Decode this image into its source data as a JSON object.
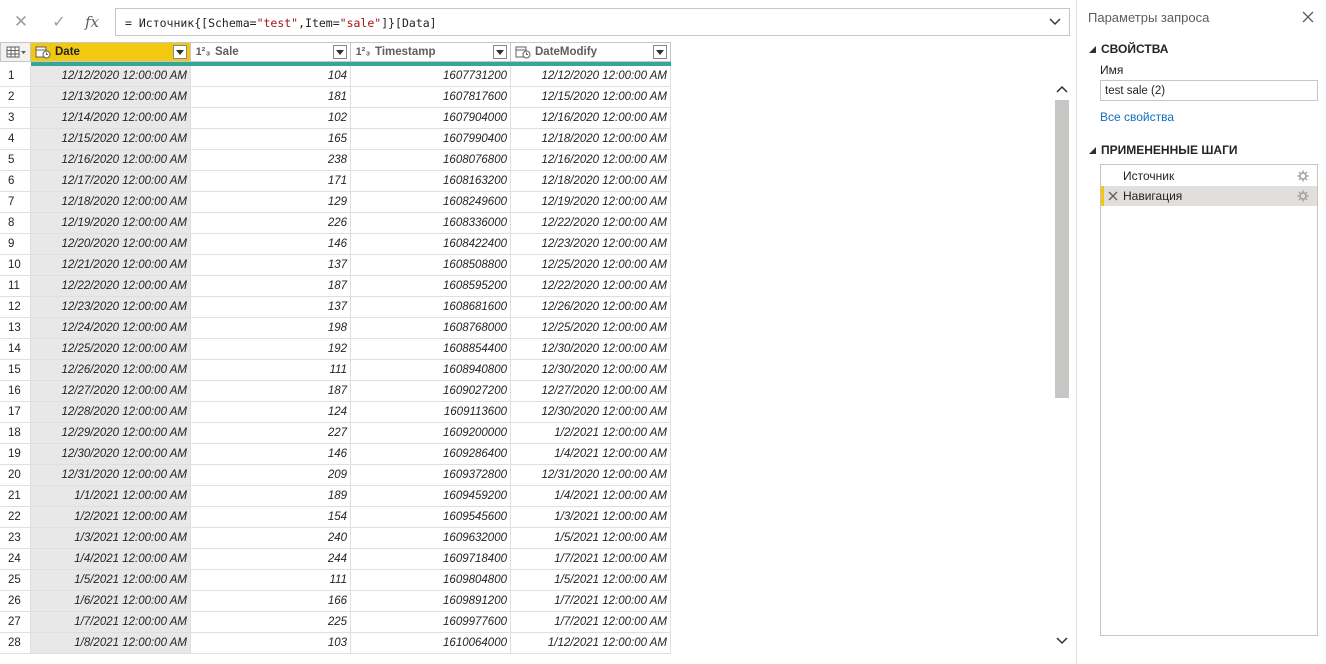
{
  "formula": {
    "prefix": "= Источник{[Schema=",
    "s1": "\"test\"",
    "mid": ",Item=",
    "s2": "\"sale\"",
    "suffix": "]}[Data]"
  },
  "columns": [
    {
      "label": "Date",
      "type_icon": "datetime-type-icon",
      "selected": true
    },
    {
      "label": "Sale",
      "type_icon": "number-type-icon",
      "selected": false
    },
    {
      "label": "Timestamp",
      "type_icon": "number-type-icon",
      "selected": false
    },
    {
      "label": "DateModify",
      "type_icon": "datetime-type-icon",
      "selected": false
    }
  ],
  "rows": [
    {
      "n": "1",
      "date": "12/12/2020 12:00:00 AM",
      "sale": "104",
      "ts": "1607731200",
      "mod": "12/12/2020 12:00:00 AM"
    },
    {
      "n": "2",
      "date": "12/13/2020 12:00:00 AM",
      "sale": "181",
      "ts": "1607817600",
      "mod": "12/15/2020 12:00:00 AM"
    },
    {
      "n": "3",
      "date": "12/14/2020 12:00:00 AM",
      "sale": "102",
      "ts": "1607904000",
      "mod": "12/16/2020 12:00:00 AM"
    },
    {
      "n": "4",
      "date": "12/15/2020 12:00:00 AM",
      "sale": "165",
      "ts": "1607990400",
      "mod": "12/18/2020 12:00:00 AM"
    },
    {
      "n": "5",
      "date": "12/16/2020 12:00:00 AM",
      "sale": "238",
      "ts": "1608076800",
      "mod": "12/16/2020 12:00:00 AM"
    },
    {
      "n": "6",
      "date": "12/17/2020 12:00:00 AM",
      "sale": "171",
      "ts": "1608163200",
      "mod": "12/18/2020 12:00:00 AM"
    },
    {
      "n": "7",
      "date": "12/18/2020 12:00:00 AM",
      "sale": "129",
      "ts": "1608249600",
      "mod": "12/19/2020 12:00:00 AM"
    },
    {
      "n": "8",
      "date": "12/19/2020 12:00:00 AM",
      "sale": "226",
      "ts": "1608336000",
      "mod": "12/22/2020 12:00:00 AM"
    },
    {
      "n": "9",
      "date": "12/20/2020 12:00:00 AM",
      "sale": "146",
      "ts": "1608422400",
      "mod": "12/23/2020 12:00:00 AM"
    },
    {
      "n": "10",
      "date": "12/21/2020 12:00:00 AM",
      "sale": "137",
      "ts": "1608508800",
      "mod": "12/25/2020 12:00:00 AM"
    },
    {
      "n": "11",
      "date": "12/22/2020 12:00:00 AM",
      "sale": "187",
      "ts": "1608595200",
      "mod": "12/22/2020 12:00:00 AM"
    },
    {
      "n": "12",
      "date": "12/23/2020 12:00:00 AM",
      "sale": "137",
      "ts": "1608681600",
      "mod": "12/26/2020 12:00:00 AM"
    },
    {
      "n": "13",
      "date": "12/24/2020 12:00:00 AM",
      "sale": "198",
      "ts": "1608768000",
      "mod": "12/25/2020 12:00:00 AM"
    },
    {
      "n": "14",
      "date": "12/25/2020 12:00:00 AM",
      "sale": "192",
      "ts": "1608854400",
      "mod": "12/30/2020 12:00:00 AM"
    },
    {
      "n": "15",
      "date": "12/26/2020 12:00:00 AM",
      "sale": "111",
      "ts": "1608940800",
      "mod": "12/30/2020 12:00:00 AM"
    },
    {
      "n": "16",
      "date": "12/27/2020 12:00:00 AM",
      "sale": "187",
      "ts": "1609027200",
      "mod": "12/27/2020 12:00:00 AM"
    },
    {
      "n": "17",
      "date": "12/28/2020 12:00:00 AM",
      "sale": "124",
      "ts": "1609113600",
      "mod": "12/30/2020 12:00:00 AM"
    },
    {
      "n": "18",
      "date": "12/29/2020 12:00:00 AM",
      "sale": "227",
      "ts": "1609200000",
      "mod": "1/2/2021 12:00:00 AM"
    },
    {
      "n": "19",
      "date": "12/30/2020 12:00:00 AM",
      "sale": "146",
      "ts": "1609286400",
      "mod": "1/4/2021 12:00:00 AM"
    },
    {
      "n": "20",
      "date": "12/31/2020 12:00:00 AM",
      "sale": "209",
      "ts": "1609372800",
      "mod": "12/31/2020 12:00:00 AM"
    },
    {
      "n": "21",
      "date": "1/1/2021 12:00:00 AM",
      "sale": "189",
      "ts": "1609459200",
      "mod": "1/4/2021 12:00:00 AM"
    },
    {
      "n": "22",
      "date": "1/2/2021 12:00:00 AM",
      "sale": "154",
      "ts": "1609545600",
      "mod": "1/3/2021 12:00:00 AM"
    },
    {
      "n": "23",
      "date": "1/3/2021 12:00:00 AM",
      "sale": "240",
      "ts": "1609632000",
      "mod": "1/5/2021 12:00:00 AM"
    },
    {
      "n": "24",
      "date": "1/4/2021 12:00:00 AM",
      "sale": "244",
      "ts": "1609718400",
      "mod": "1/7/2021 12:00:00 AM"
    },
    {
      "n": "25",
      "date": "1/5/2021 12:00:00 AM",
      "sale": "111",
      "ts": "1609804800",
      "mod": "1/5/2021 12:00:00 AM"
    },
    {
      "n": "26",
      "date": "1/6/2021 12:00:00 AM",
      "sale": "166",
      "ts": "1609891200",
      "mod": "1/7/2021 12:00:00 AM"
    },
    {
      "n": "27",
      "date": "1/7/2021 12:00:00 AM",
      "sale": "225",
      "ts": "1609977600",
      "mod": "1/7/2021 12:00:00 AM"
    },
    {
      "n": "28",
      "date": "1/8/2021 12:00:00 AM",
      "sale": "103",
      "ts": "1610064000",
      "mod": "1/12/2021 12:00:00 AM"
    }
  ],
  "pane": {
    "title": "Параметры запроса",
    "properties_header": "СВОЙСТВА",
    "name_label": "Имя",
    "name_value": "test sale (2)",
    "all_properties": "Все свойства",
    "steps_header": "ПРИМЕНЕННЫЕ ШАГИ",
    "steps": [
      {
        "label": "Источник",
        "active": false
      },
      {
        "label": "Навигация",
        "active": true
      }
    ]
  },
  "colors": {
    "accent_yellow": "#f2c811",
    "quality_bar": "#37a794",
    "link": "#106ebe"
  }
}
